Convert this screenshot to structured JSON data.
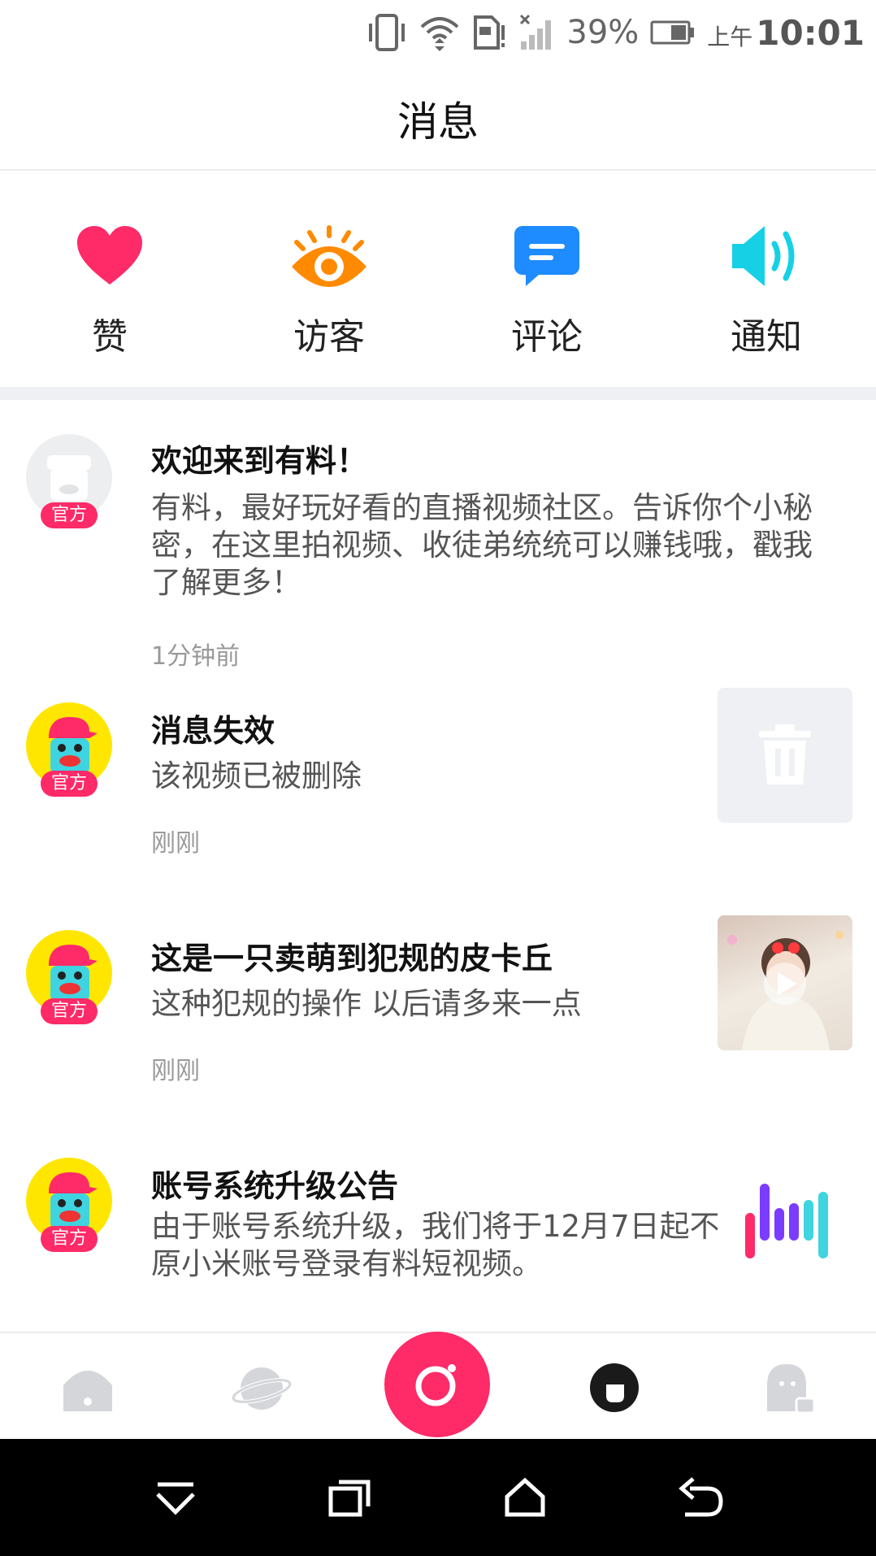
{
  "status_bar": {
    "battery_percent": "39%",
    "time_prefix": "上午",
    "time": "10:01"
  },
  "header": {
    "title": "消息"
  },
  "categories": [
    {
      "label": "赞",
      "icon": "heart-icon",
      "color": "#ff2a68"
    },
    {
      "label": "访客",
      "icon": "eye-icon",
      "color": "#ff8a00"
    },
    {
      "label": "评论",
      "icon": "comment-icon",
      "color": "#1e8bff"
    },
    {
      "label": "通知",
      "icon": "speaker-icon",
      "color": "#16d1e6"
    }
  ],
  "messages": [
    {
      "title": "欢迎来到有料！",
      "body": "有料，最好玩好看的直播视频社区。告诉你个小秘密，在这里拍视频、收徒弟统统可以赚钱哦，戳我了解更多！",
      "time": "1分钟前",
      "badge": "官方"
    },
    {
      "title": "消息失效",
      "body": "该视频已被删除",
      "time": "刚刚",
      "badge": "官方"
    },
    {
      "title": "这是一只卖萌到犯规的皮卡丘",
      "body": "这种犯规的操作 以后请多来一点",
      "time": "刚刚",
      "badge": "官方"
    },
    {
      "title": "账号系统升级公告",
      "body": "由于账号系统升级，我们将于12月7日起不再支持原小米账号登录有料短视频。",
      "badge": "官方"
    }
  ],
  "bottom_nav": [
    "home-icon",
    "planet-icon",
    "camera-record-icon",
    "messages-icon",
    "profile-ghost-icon"
  ],
  "colors": {
    "accent": "#ff2a68",
    "avatar_yellow": "#ffe600",
    "divider": "#eef0f3"
  }
}
